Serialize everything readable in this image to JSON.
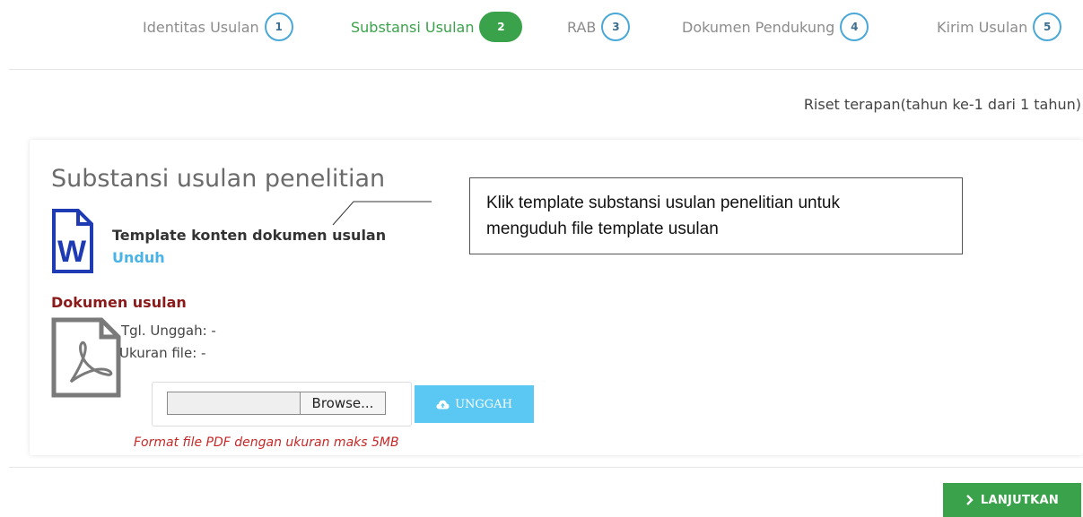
{
  "steps": [
    {
      "label": "Identitas Usulan",
      "number": "1"
    },
    {
      "label": "Substansi Usulan",
      "number": "2"
    },
    {
      "label": "RAB",
      "number": "3"
    },
    {
      "label": "Dokumen Pendukung",
      "number": "4"
    },
    {
      "label": "Kirim Usulan",
      "number": "5"
    }
  ],
  "active_step": 2,
  "scheme_info": "Riset terapan(tahun ke-1 dari 1 tahun)",
  "panel": {
    "title": "Substansi usulan penelitian",
    "template_label": "Template konten dokumen usulan",
    "template_link": "Unduh",
    "document_title": "Dokumen usulan",
    "upload_date": "Tgl. Unggah: -",
    "file_size": "Ukuran file: -",
    "browse_label": "Browse...",
    "upload_label": "UNGGAH",
    "format_note": "Format file PDF dengan ukuran maks 5MB",
    "word_icon_letter": "W"
  },
  "callout": {
    "line1": "Klik template substansi usulan penelitian untuk",
    "line2": "menguduh file template usulan"
  },
  "next_button": "LANJUTKAN",
  "colors": {
    "active_green": "#3aa24a",
    "step_border": "#4aa8d8",
    "link_blue": "#4ab3e8",
    "upload_blue": "#5ac8f2",
    "doc_title_red": "#8b1a1a",
    "note_red": "#c62828"
  },
  "icons": [
    "word-file-icon",
    "pdf-file-icon",
    "cloud-upload-icon",
    "chevron-right-icon"
  ]
}
